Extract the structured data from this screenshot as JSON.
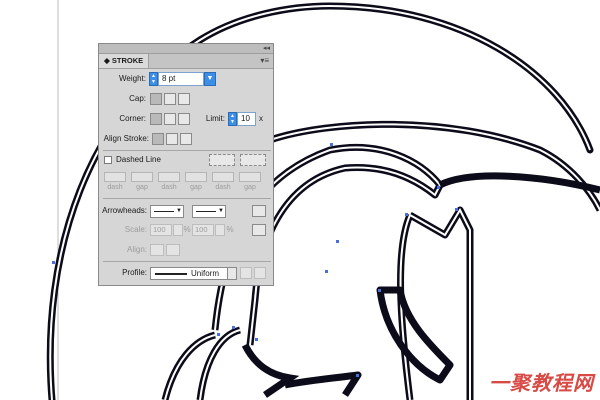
{
  "panel": {
    "title": "STROKE",
    "weight_label": "Weight:",
    "weight_value": "8 pt",
    "cap_label": "Cap:",
    "corner_label": "Corner:",
    "limit_label": "Limit:",
    "limit_value": "10",
    "limit_unit": "x",
    "align_label": "Align Stroke:",
    "dashed_label": "Dashed Line",
    "dash_labels": [
      "dash",
      "gap",
      "dash",
      "gap",
      "dash",
      "gap"
    ],
    "arrowheads_label": "Arrowheads:",
    "scale_label": "Scale:",
    "scale_start": "100",
    "scale_end": "100",
    "percent": "%",
    "align_arrow_label": "Align:",
    "profile_label": "Profile:",
    "profile_value": "Uniform"
  },
  "watermark": "一聚教程网",
  "colors": {
    "panel_bg": "#d6d6d6",
    "accent_blue": "#3c8ee6",
    "path_stroke": "#0b0b1a",
    "anchor_blue": "#4a6ee0",
    "watermark_red": "#d84a45"
  }
}
